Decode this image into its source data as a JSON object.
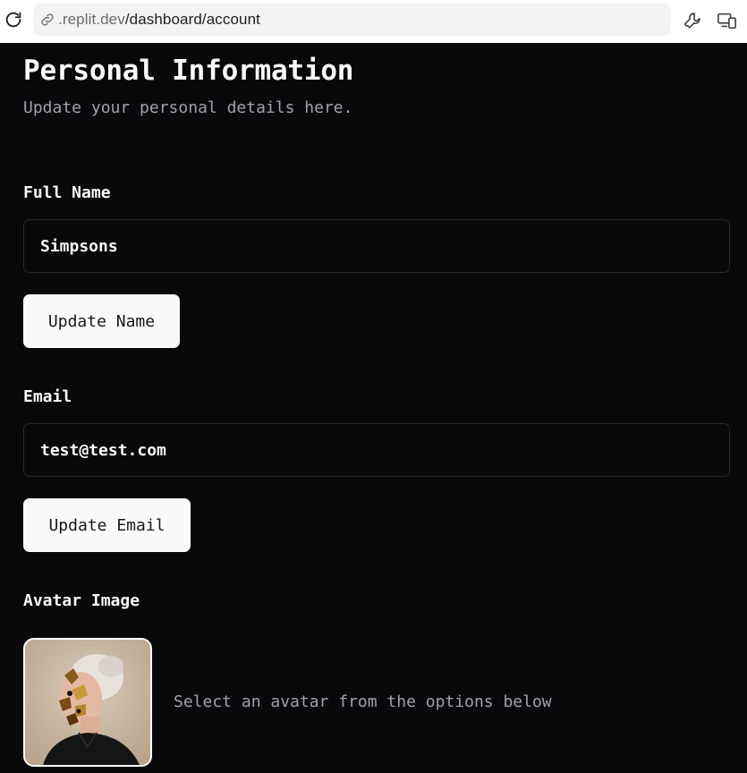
{
  "browser": {
    "url_host": ".replit.dev",
    "url_path": "/dashboard/account",
    "icons": [
      "reload-icon",
      "link-icon",
      "wrench-icon",
      "devices-icon"
    ]
  },
  "header": {
    "title": "Personal Information",
    "subtitle": "Update your personal details here."
  },
  "full_name": {
    "label": "Full Name",
    "value": "Simpsons",
    "button_label": "Update Name"
  },
  "email": {
    "label": "Email",
    "value": "test@test.com",
    "button_label": "Update Email"
  },
  "avatar": {
    "label": "Avatar Image",
    "hint": "Select an avatar from the options below"
  },
  "colors": {
    "background": "#09090b",
    "foreground": "#fafafa",
    "muted": "#a1a1aa",
    "border": "#27272a",
    "button_bg": "#fafafa"
  }
}
